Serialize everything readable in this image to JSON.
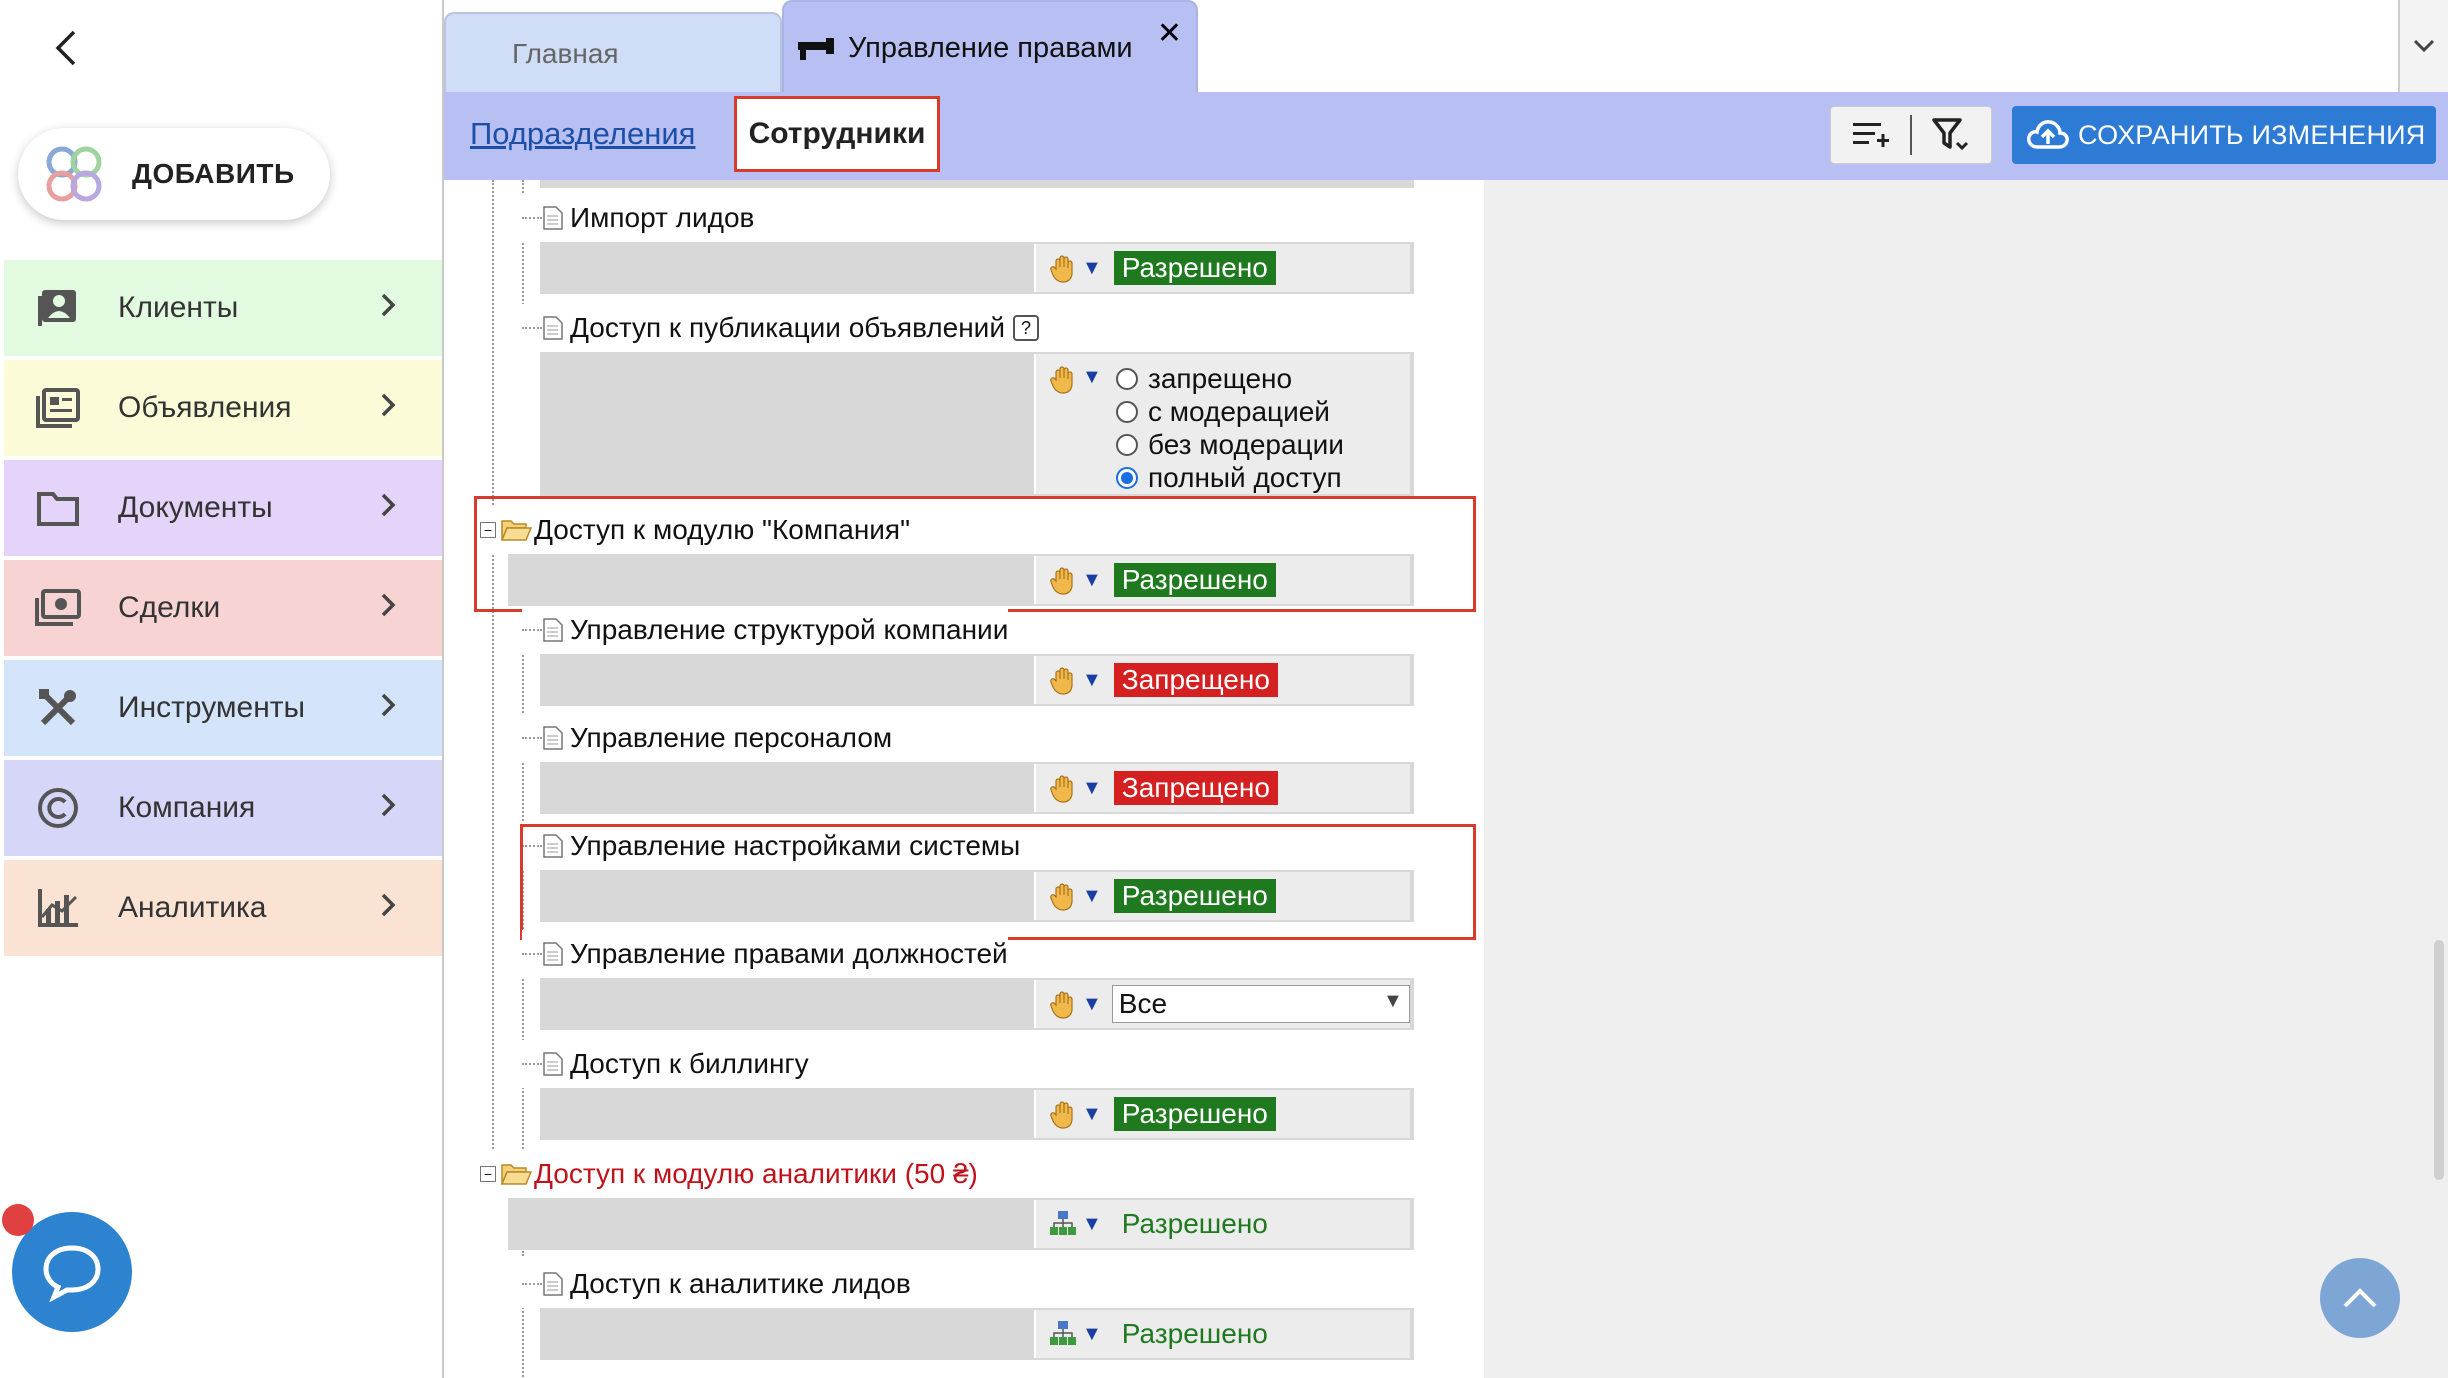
{
  "sidebar": {
    "add_label": "ДОБАВИТЬ",
    "items": [
      {
        "label": "Клиенты",
        "icon": "contacts-icon",
        "color": "#e2fbe0"
      },
      {
        "label": "Объявления",
        "icon": "listings-icon",
        "color": "#fbfbd8"
      },
      {
        "label": "Документы",
        "icon": "folder-icon",
        "color": "#e5d4fa"
      },
      {
        "label": "Сделки",
        "icon": "money-icon",
        "color": "#f8d3d3"
      },
      {
        "label": "Инструменты",
        "icon": "tools-icon",
        "color": "#d3e4fb"
      },
      {
        "label": "Компания",
        "icon": "copyright-icon",
        "color": "#d6d6f8"
      },
      {
        "label": "Аналитика",
        "icon": "analytics-icon",
        "color": "#fbe3d3"
      }
    ]
  },
  "tabs": {
    "home": "Главная",
    "rights": "Управление правами",
    "close": "✕"
  },
  "subbar": {
    "divisions": "Подразделения",
    "employees": "Сотрудники",
    "save": "СОХРАНИТЬ ИЗМЕНЕНИЯ"
  },
  "tree": {
    "import_leads": {
      "label": "Импорт лидов",
      "status": "Разрешено"
    },
    "publish_access": {
      "label": "Доступ к публикации объявлений",
      "help": "?",
      "options": [
        "запрещено",
        "с модерацией",
        "без модерации",
        "полный доступ"
      ],
      "selected": "полный доступ"
    },
    "company_module": {
      "label": "Доступ к модулю \"Компания\"",
      "status": "Разрешено"
    },
    "structure": {
      "label": "Управление структурой компании",
      "status": "Запрещено"
    },
    "personnel": {
      "label": "Управление персоналом",
      "status": "Запрещено"
    },
    "system_settings": {
      "label": "Управление настройками системы",
      "status": "Разрешено"
    },
    "position_rights": {
      "label": "Управление правами должностей",
      "value": "Все"
    },
    "billing": {
      "label": "Доступ к биллингу",
      "status": "Разрешено"
    },
    "analytics_module": {
      "label": "Доступ к модулю аналитики (50 ₴)",
      "status": "Разрешено"
    },
    "leads_analytics": {
      "label": "Доступ к аналитике лидов",
      "status": "Разрешено"
    }
  },
  "colors": {
    "accent": "#b8c0f3",
    "save": "#2e7bd6",
    "allowed": "#1f7a1f",
    "denied": "#d42020",
    "highlight": "#d63b2b"
  }
}
